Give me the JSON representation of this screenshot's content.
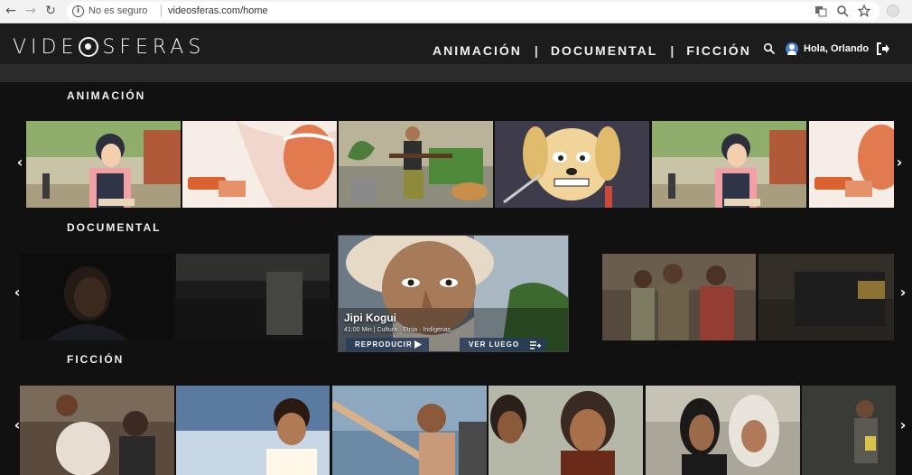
{
  "browser": {
    "back_glyph": "←",
    "forward_glyph": "→",
    "reload_glyph": "↻",
    "security_label": "No es seguro",
    "url": "videosferas.com/home"
  },
  "site": {
    "logo_left": "VIDE",
    "logo_right": "SFERAS",
    "nav": [
      "ANIMACIÓN",
      "DOCUMENTAL",
      "FICCIÓN"
    ],
    "nav_separator": "|",
    "greeting": "Hola, Orlando"
  },
  "sections": {
    "animacion": {
      "title": "ANIMACIÓN"
    },
    "documental": {
      "title": "DOCUMENTAL"
    },
    "ficcion": {
      "title": "FICCIÓN"
    }
  },
  "featured": {
    "title": "Jipi Kogui",
    "meta": "41:00 Min | Cultura · Etnia · Indígenas",
    "play_label": "REPRODUCIR",
    "later_label": "VER LUEGO"
  },
  "arrows": {
    "left": "‹",
    "right": "›"
  },
  "colors": {
    "accent_blue": "#4a7fc9",
    "header_bg": "#1c1c1c",
    "page_bg": "#111111"
  }
}
